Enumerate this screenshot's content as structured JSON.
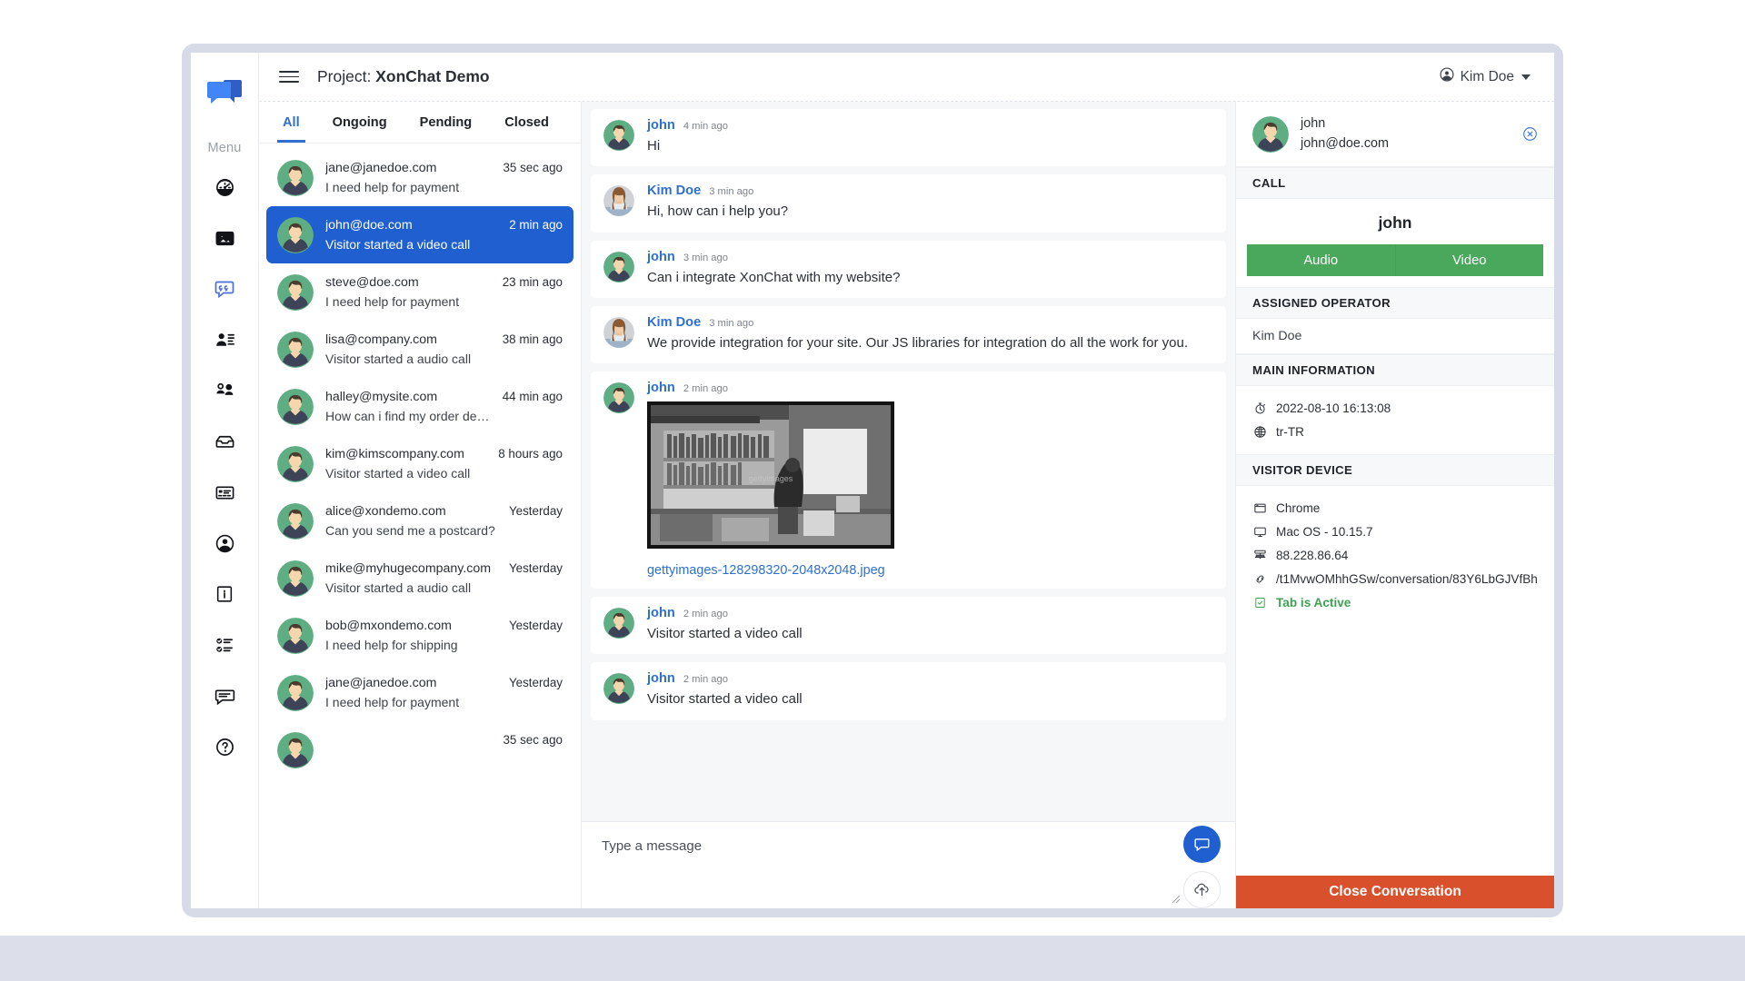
{
  "brand": {
    "logo_icon": "chat-bubbles-logo",
    "accent_blue": "#1f5fd0",
    "link_blue": "#2f6fd0",
    "green": "#4aa85c",
    "red": "#d9512c",
    "status_green": "#3fa152"
  },
  "topbar": {
    "menu_icon": "hamburger-icon",
    "title_prefix": "Project: ",
    "title_project": "XonChat Demo",
    "user_name": "Kim Doe",
    "user_icon": "user-circle-icon",
    "caret_icon": "chevron-down-icon"
  },
  "rail": {
    "menu_label": "Menu",
    "items": [
      {
        "icon": "dashboard-gauge-icon",
        "active": false
      },
      {
        "icon": "image-icon",
        "active": false
      },
      {
        "icon": "chat-quote-icon",
        "active": true
      },
      {
        "icon": "user-details-icon",
        "active": false
      },
      {
        "icon": "users-group-icon",
        "active": false
      },
      {
        "icon": "inbox-icon",
        "active": false
      },
      {
        "icon": "card-list-icon",
        "active": false
      },
      {
        "icon": "account-circle-icon",
        "active": false
      },
      {
        "icon": "info-square-icon",
        "active": false
      },
      {
        "icon": "checklist-icon",
        "active": false
      },
      {
        "icon": "comment-lines-icon",
        "active": false
      },
      {
        "icon": "question-circle-icon",
        "active": false
      }
    ]
  },
  "conversations": {
    "tabs": [
      {
        "label": "All",
        "active": true
      },
      {
        "label": "Ongoing",
        "active": false
      },
      {
        "label": "Pending",
        "active": false
      },
      {
        "label": "Closed",
        "active": false
      }
    ],
    "items": [
      {
        "email": "jane@janedoe.com",
        "snippet": "I need help for payment",
        "time": "35 sec ago",
        "selected": false
      },
      {
        "email": "john@doe.com",
        "snippet": "Visitor started a video call",
        "time": "2 min ago",
        "selected": true
      },
      {
        "email": "steve@doe.com",
        "snippet": "I need help for payment",
        "time": "23 min ago",
        "selected": false
      },
      {
        "email": "lisa@company.com",
        "snippet": "Visitor started a audio call",
        "time": "38 min ago",
        "selected": false
      },
      {
        "email": "halley@mysite.com",
        "snippet": "How can i find my order detail on …",
        "time": "44 min ago",
        "selected": false
      },
      {
        "email": "kim@kimscompany.com",
        "snippet": "Visitor started a video call",
        "time": "8 hours ago",
        "selected": false
      },
      {
        "email": "alice@xondemo.com",
        "snippet": "Can you send me a postcard?",
        "time": "Yesterday",
        "selected": false
      },
      {
        "email": "mike@myhugecompany.com",
        "snippet": "Visitor started a audio call",
        "time": "Yesterday",
        "selected": false
      },
      {
        "email": "bob@mxondemo.com",
        "snippet": "I need help for shipping",
        "time": "Yesterday",
        "selected": false
      },
      {
        "email": "jane@janedoe.com",
        "snippet": "I need help for payment",
        "time": "Yesterday",
        "selected": false
      },
      {
        "email": "",
        "snippet": "",
        "time": "35 sec ago",
        "selected": false
      }
    ]
  },
  "chat": {
    "messages": [
      {
        "author": "john",
        "time": "4 min ago",
        "text": "Hi",
        "avatar": "visitor-avatar",
        "type": "text"
      },
      {
        "author": "Kim Doe",
        "time": "3 min ago",
        "text": "Hi, how can i help you?",
        "avatar": "operator-avatar",
        "type": "text"
      },
      {
        "author": "john",
        "time": "3 min ago",
        "text": "Can i integrate XonChat with my website?",
        "avatar": "visitor-avatar",
        "type": "text"
      },
      {
        "author": "Kim Doe",
        "time": "3 min ago",
        "text": "We provide integration for your site. Our JS libraries for integration do all the work for you.",
        "avatar": "operator-avatar",
        "type": "text"
      },
      {
        "author": "john",
        "time": "2 min ago",
        "text": "",
        "avatar": "visitor-avatar",
        "type": "image",
        "file_name": "gettyimages-128298320-2048x2048.jpeg"
      },
      {
        "author": "john",
        "time": "2 min ago",
        "text": "Visitor started a video call",
        "avatar": "visitor-avatar",
        "type": "text"
      },
      {
        "author": "john",
        "time": "2 min ago",
        "text": "Visitor started a video call",
        "avatar": "visitor-avatar",
        "type": "text"
      }
    ],
    "composer": {
      "placeholder": "Type a message",
      "send_icon": "chat-send-icon",
      "upload_icon": "cloud-upload-icon",
      "resize_icon": "resize-grip-icon"
    }
  },
  "info": {
    "header": {
      "name": "john",
      "email": "john@doe.com",
      "close_icon": "close-circle-icon"
    },
    "call": {
      "section_label": "CALL",
      "target_name": "john",
      "audio_label": "Audio",
      "video_label": "Video"
    },
    "operator": {
      "section_label": "ASSIGNED OPERATOR",
      "name": "Kim Doe"
    },
    "main_information": {
      "section_label": "MAIN INFORMATION",
      "rows": [
        {
          "icon": "stopwatch-icon",
          "value": "2022-08-10 16:13:08"
        },
        {
          "icon": "globe-icon",
          "value": "tr-TR"
        }
      ]
    },
    "visitor_device": {
      "section_label": "VISITOR DEVICE",
      "rows": [
        {
          "icon": "browser-window-icon",
          "value": "Chrome",
          "status": false
        },
        {
          "icon": "monitor-icon",
          "value": "Mac OS - 10.15.7",
          "status": false
        },
        {
          "icon": "network-icon",
          "value": "88.228.86.64",
          "status": false
        },
        {
          "icon": "link-icon",
          "value": "/t1MvwOMhhGSw/conversation/83Y6LbGJVfBh",
          "status": false
        },
        {
          "icon": "tab-check-icon",
          "value": "Tab is Active",
          "status": true
        }
      ]
    },
    "close_conversation_label": "Close Conversation"
  }
}
